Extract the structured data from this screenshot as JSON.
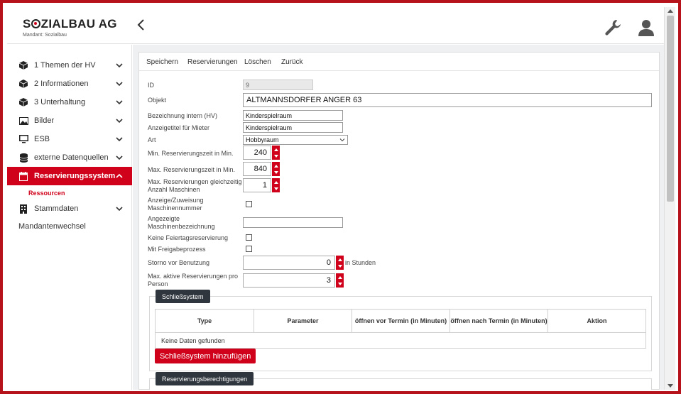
{
  "header": {
    "logo": "SOZIALBAU AG",
    "logo_pre": "S",
    "logo_post": "ZIALBAU AG",
    "mandant": "Mandant: Sozialbau"
  },
  "sidebar": {
    "items": [
      {
        "label": "1 Themen der HV",
        "icon": "cube-icon"
      },
      {
        "label": "2 Informationen",
        "icon": "cube-icon"
      },
      {
        "label": "3 Unterhaltung",
        "icon": "cube-icon"
      },
      {
        "label": "Bilder",
        "icon": "image-icon"
      },
      {
        "label": "ESB",
        "icon": "monitor-icon"
      },
      {
        "label": "externe Datenquellen",
        "icon": "database-icon"
      },
      {
        "label": "Reservierungssystem",
        "icon": "calendar-icon"
      },
      {
        "label": "Stammdaten",
        "icon": "building-icon"
      }
    ],
    "active_sub": "Ressourcen",
    "mandantenwechsel": "Mandantenwechsel"
  },
  "toolbar": {
    "save": "Speichern",
    "reservations": "Reservierungen",
    "delete": "Löschen",
    "back": "Zurück"
  },
  "form": {
    "id_label": "ID",
    "id_value": "9",
    "objekt_label": "Objekt",
    "objekt_value": "ALTMANNSDORFER ANGER 63",
    "bez_label": "Bezeichnung intern (HV)",
    "bez_value": "Kinderspielraum",
    "titel_label": "Anzeigetitel für Mieter",
    "titel_value": "Kinderspielraum",
    "art_label": "Art",
    "art_value": "Hobbyraum",
    "min_label": "Min. Reservierungszeit in Min.",
    "min_value": "240",
    "max_label": "Max. Reservierungszeit in Min.",
    "max_value": "840",
    "gleich_label_1": "Max. Reservierungen gleichzeitig /",
    "gleich_label_2": "Anzahl Maschinen",
    "gleich_value": "1",
    "anzeige_label_1": "Anzeige/Zuweisung",
    "anzeige_label_2": "Maschinennummer",
    "masch_label_1": "Angezeigte",
    "masch_label_2": "Maschinenbezeichnung",
    "masch_value": "",
    "feiertag_label": "Keine Feiertagsreservierung",
    "freigabe_label": "Mit Freigabeprozess",
    "storno_label": "Storno vor Benutzung",
    "storno_value": "0",
    "storno_unit": "in Stunden",
    "aktiv_label_1": "Max. aktive Reservierungen pro",
    "aktiv_label_2": "Person",
    "aktiv_value": "3"
  },
  "schliess": {
    "title": "Schließsystem",
    "columns": [
      "Type",
      "Parameter",
      "öffnen vor Termin (in Minuten)",
      "öffnen nach Termin (in Minuten)",
      "Aktion"
    ],
    "empty": "Keine Daten gefunden",
    "add": "Schließsystem hinzufügen"
  },
  "berecht": {
    "title": "Reservierungsberechtigungen"
  },
  "colors": {
    "accent": "#d0021b",
    "dark": "#2f363d",
    "frame": "#b5121b"
  }
}
